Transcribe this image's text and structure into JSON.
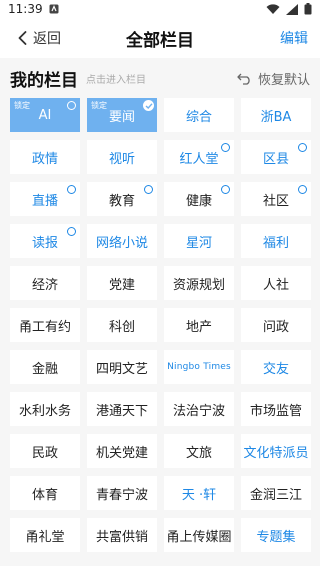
{
  "status_bar": {
    "time": "11:39"
  },
  "nav": {
    "back_label": "返回",
    "title": "全部栏目",
    "edit_label": "编辑"
  },
  "section": {
    "title": "我的栏目",
    "hint": "点击进入栏目",
    "reset_label": "恢复默认"
  },
  "tiles": [
    {
      "label": "AI",
      "fixed": true,
      "fixed_tag": "锁定",
      "badge": "circle"
    },
    {
      "label": "要闻",
      "fixed": true,
      "fixed_tag": "锁定",
      "badge": "check"
    },
    {
      "label": "综合",
      "blue": true
    },
    {
      "label": "浙BA",
      "blue": true
    },
    {
      "label": "政情",
      "blue": true
    },
    {
      "label": "视听",
      "blue": true
    },
    {
      "label": "红人堂",
      "blue": true,
      "badge": "circle"
    },
    {
      "label": "区县",
      "blue": true,
      "badge": "circle"
    },
    {
      "label": "直播",
      "blue": true,
      "badge": "circle"
    },
    {
      "label": "教育",
      "badge": "circle"
    },
    {
      "label": "健康",
      "badge": "circle"
    },
    {
      "label": "社区",
      "badge": "circle"
    },
    {
      "label": "读报",
      "blue": true,
      "badge": "circle"
    },
    {
      "label": "网络小说",
      "blue": true
    },
    {
      "label": "星河",
      "blue": true
    },
    {
      "label": "福利",
      "blue": true
    },
    {
      "label": "经济"
    },
    {
      "label": "党建"
    },
    {
      "label": "资源规划"
    },
    {
      "label": "人社"
    },
    {
      "label": "甬工有约"
    },
    {
      "label": "科创"
    },
    {
      "label": "地产"
    },
    {
      "label": "问政"
    },
    {
      "label": "金融"
    },
    {
      "label": "四明文艺"
    },
    {
      "label": "Ningbo Times",
      "blue": true,
      "small": true
    },
    {
      "label": "交友",
      "blue": true
    },
    {
      "label": "水利水务"
    },
    {
      "label": "港通天下"
    },
    {
      "label": "法治宁波"
    },
    {
      "label": "市场监管"
    },
    {
      "label": "民政"
    },
    {
      "label": "机关党建"
    },
    {
      "label": "文旅"
    },
    {
      "label": "文化特派员",
      "blue": true
    },
    {
      "label": "体育"
    },
    {
      "label": "青春宁波"
    },
    {
      "label": "天 ·轩",
      "blue": true
    },
    {
      "label": "金润三江"
    },
    {
      "label": "甬礼堂"
    },
    {
      "label": "共富供销"
    },
    {
      "label": "甬上传媒圈"
    },
    {
      "label": "专题集",
      "blue": true
    }
  ]
}
